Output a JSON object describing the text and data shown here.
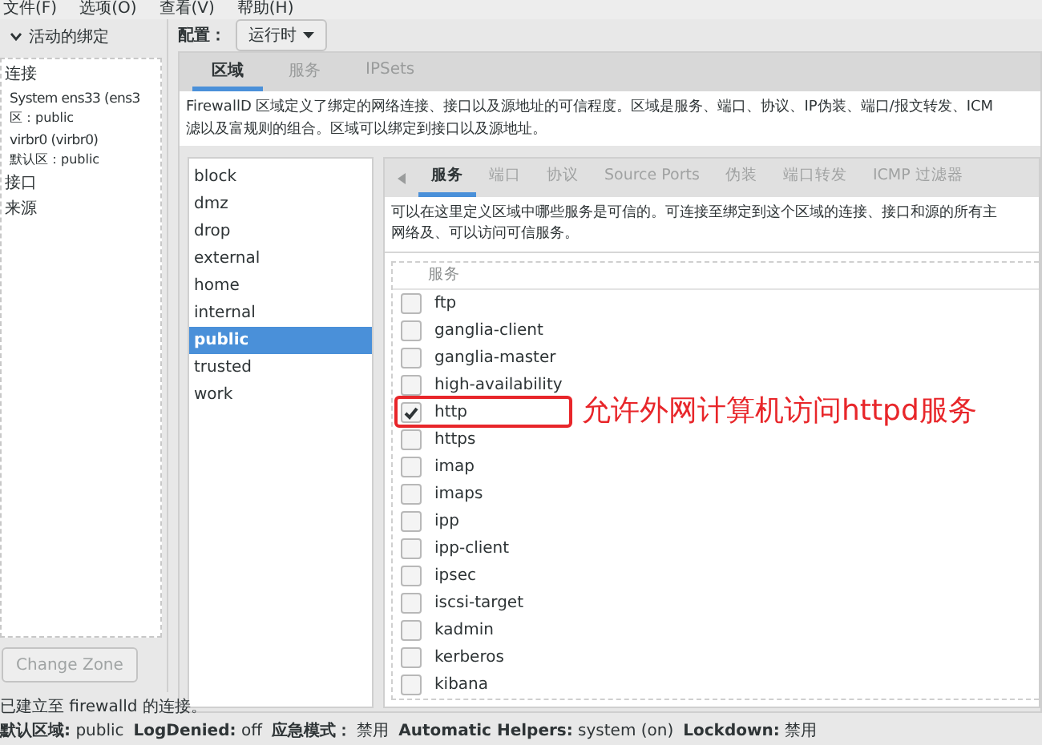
{
  "menu": [
    "文件(F)",
    "选项(O)",
    "查看(V)",
    "帮助(H)"
  ],
  "bindings": {
    "title": "活动的绑定",
    "expanded": true,
    "groups": [
      {
        "label": "连接",
        "children": [
          {
            "name": "System ens33 (ens3",
            "zone": "区：public"
          },
          {
            "name": "virbr0 (virbr0)",
            "zone": "默认区：public"
          }
        ]
      },
      {
        "label": "接口"
      },
      {
        "label": "来源"
      }
    ],
    "button": {
      "label": "Change Zone",
      "disabled": true
    }
  },
  "config": {
    "label": "配置：",
    "value": "运行时"
  },
  "tabs": [
    {
      "label": "区域",
      "selected": true
    },
    {
      "label": "服务",
      "selected": false
    },
    {
      "label": "IPSets",
      "selected": false
    }
  ],
  "description": [
    "FirewallD 区域定义了绑定的网络连接、接口以及源地址的可信程度。区域是服务、端口、协议、IP伪装、端口/报文转发、ICM",
    "滤以及富规则的组合。区域可以绑定到接口以及源地址。"
  ],
  "zones": [
    {
      "label": "block",
      "selected": false
    },
    {
      "label": "dmz",
      "selected": false
    },
    {
      "label": "drop",
      "selected": false
    },
    {
      "label": "external",
      "selected": false
    },
    {
      "label": "home",
      "selected": false
    },
    {
      "label": "internal",
      "selected": false
    },
    {
      "label": "public",
      "selected": true
    },
    {
      "label": "trusted",
      "selected": false
    },
    {
      "label": "work",
      "selected": false
    }
  ],
  "zone_tabs": [
    {
      "label": "服务",
      "selected": true
    },
    {
      "label": "端口",
      "selected": false
    },
    {
      "label": "协议",
      "selected": false
    },
    {
      "label": "Source Ports",
      "selected": false
    },
    {
      "label": "伪装",
      "selected": false
    },
    {
      "label": "端口转发",
      "selected": false
    },
    {
      "label": "ICMP 过滤器",
      "selected": false
    }
  ],
  "services_description": [
    "可以在这里定义区域中哪些服务是可信的。可连接至绑定到这个区域的连接、接口和源的所有主",
    "网络及、可以访问可信服务。"
  ],
  "services_table": {
    "column": "服务",
    "rows": [
      {
        "name": "ftp",
        "checked": false
      },
      {
        "name": "ganglia-client",
        "checked": false
      },
      {
        "name": "ganglia-master",
        "checked": false
      },
      {
        "name": "high-availability",
        "checked": false
      },
      {
        "name": "http",
        "checked": true
      },
      {
        "name": "https",
        "checked": false
      },
      {
        "name": "imap",
        "checked": false
      },
      {
        "name": "imaps",
        "checked": false
      },
      {
        "name": "ipp",
        "checked": false
      },
      {
        "name": "ipp-client",
        "checked": false
      },
      {
        "name": "ipsec",
        "checked": false
      },
      {
        "name": "iscsi-target",
        "checked": false
      },
      {
        "name": "kadmin",
        "checked": false
      },
      {
        "name": "kerberos",
        "checked": false
      },
      {
        "name": "kibana",
        "checked": false
      }
    ]
  },
  "annotation": {
    "text": "允许外网计算机访问httpd服务"
  },
  "status_bar": {
    "message": "已建立至  firewalld 的连接。",
    "items": [
      {
        "label": "默认区域:",
        "value": "public"
      },
      {
        "label": "LogDenied:",
        "value": "off"
      },
      {
        "label": "应急模式：",
        "value": "禁用"
      },
      {
        "label": "Automatic Helpers:",
        "value": "system (on)"
      },
      {
        "label": "Lockdown:",
        "value": "禁用"
      }
    ]
  }
}
